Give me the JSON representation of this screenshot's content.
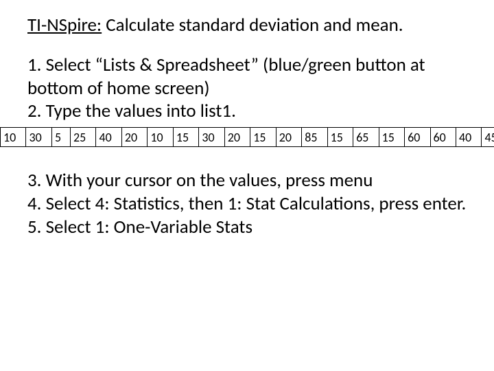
{
  "title_lead": "TI-NSpire:",
  "title_rest": " Calculate standard deviation and mean.",
  "step1": "1. Select “Lists  & Spreadsheet” (blue/green button at bottom of home screen)",
  "step2": "2. Type the values into list1.",
  "step3": "3. With your cursor on the values, press menu",
  "step4": "4. Select 4: Statistics, then 1: Stat Calculations, press enter.",
  "step5": "5. Select 1: One-Variable Stats",
  "values": [
    "10",
    "30",
    "5",
    "25",
    "40",
    "20",
    "10",
    "15",
    "30",
    "20",
    "15",
    "20",
    "85",
    "15",
    "65",
    "15",
    "60",
    "60",
    "40",
    "45"
  ]
}
